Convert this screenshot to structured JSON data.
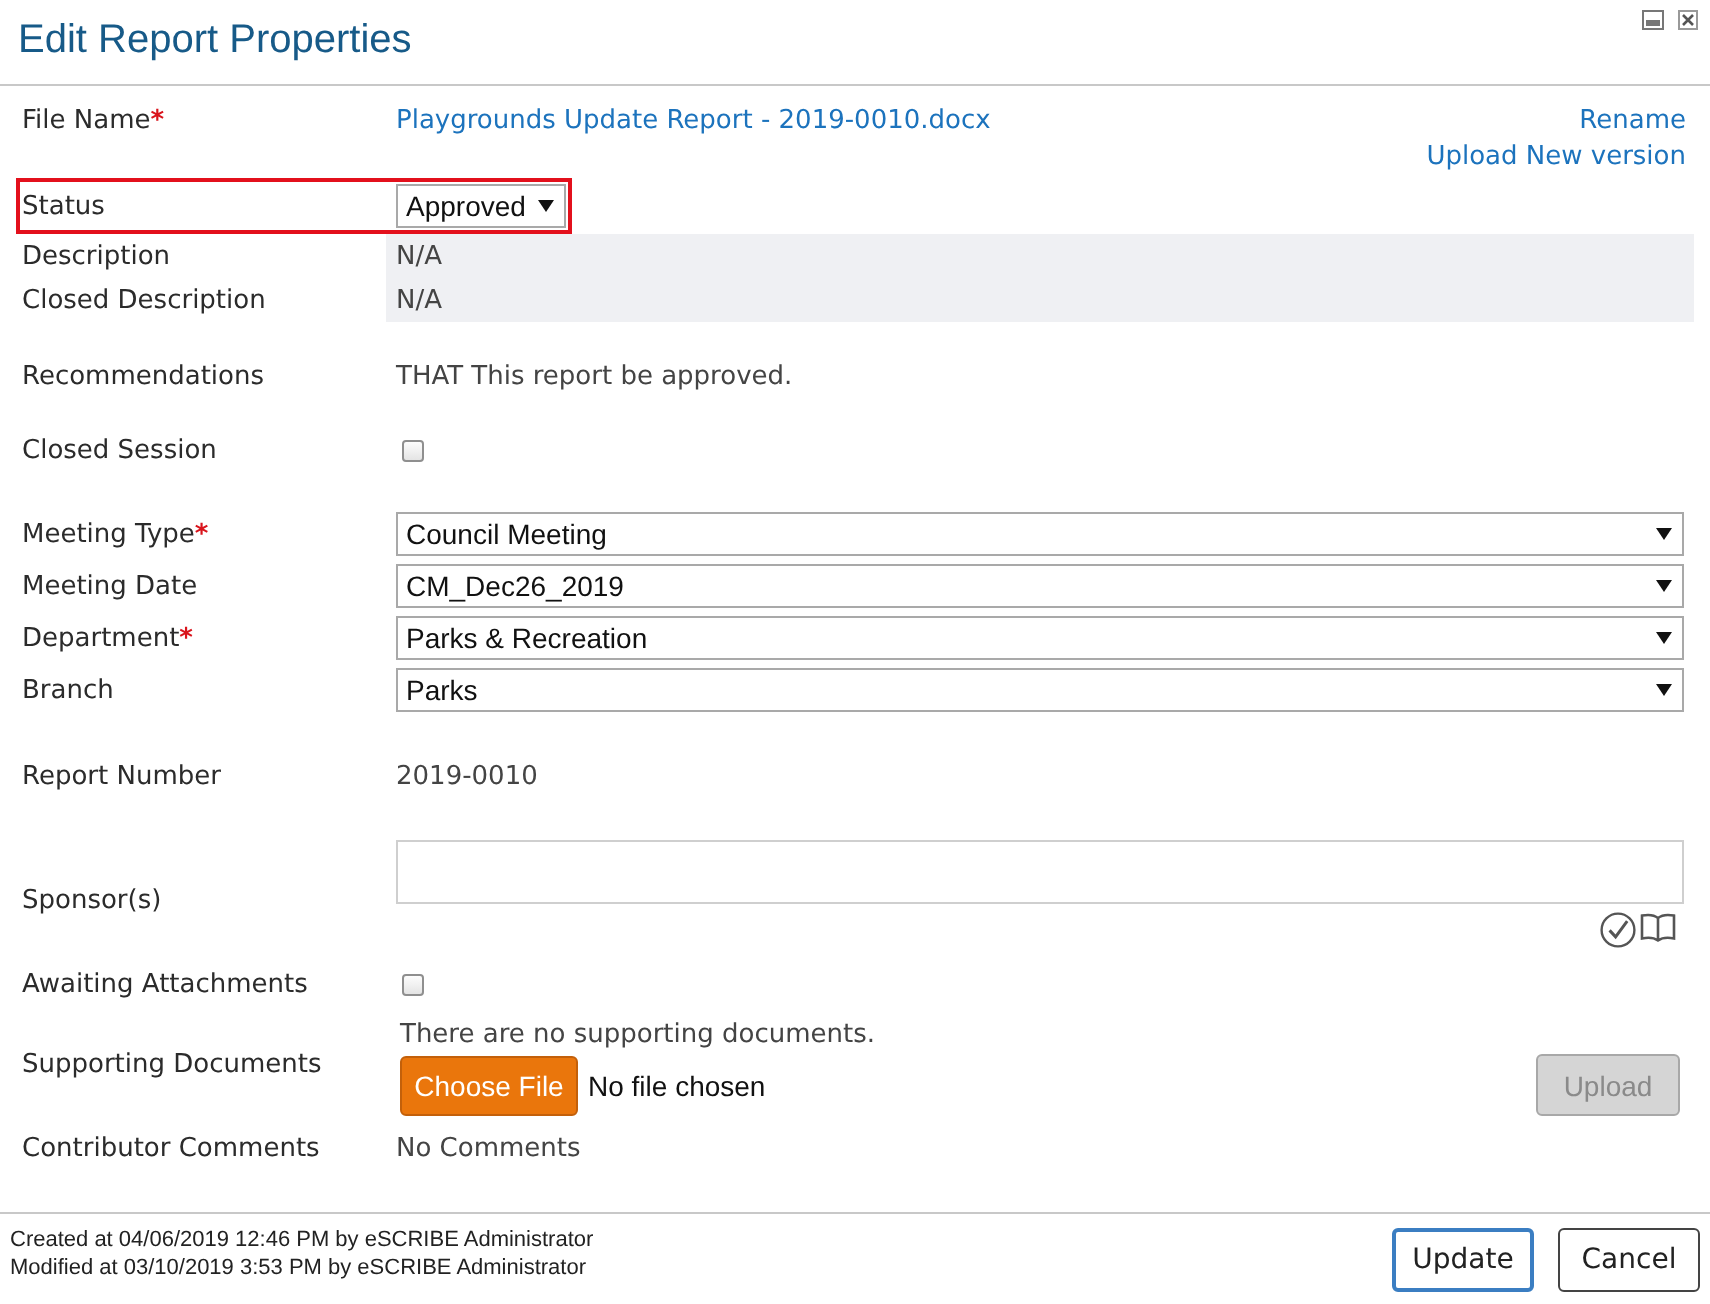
{
  "dialog": {
    "title": "Edit Report Properties"
  },
  "required_marker": "*",
  "sections": [
    {
      "fields": [
        {
          "kind": "link",
          "label": "File Name",
          "required": true,
          "highlighted": false,
          "value": "Playgrounds Update Report - 2019-0010.docx",
          "actions": [
            "Rename",
            "Upload New version"
          ]
        },
        {
          "kind": "short_select",
          "label": "Status",
          "required": false,
          "highlighted": true,
          "value": "Approved"
        },
        {
          "kind": "shaded",
          "label": "Description",
          "required": false,
          "highlighted": false,
          "value": "N/A"
        },
        {
          "kind": "shaded",
          "label": "Closed Description",
          "required": false,
          "highlighted": false,
          "value": "N/A"
        }
      ]
    },
    {
      "fields": [
        {
          "kind": "text",
          "label": "Recommendations",
          "required": false,
          "highlighted": false,
          "value": "THAT This report be approved."
        },
        {
          "kind": "checkbox",
          "label": "Closed Session",
          "required": false,
          "highlighted": false,
          "checked": false
        }
      ]
    },
    {
      "fields": [
        {
          "kind": "select",
          "label": "Meeting Type",
          "required": true,
          "highlighted": false,
          "value": "Council Meeting"
        },
        {
          "kind": "select",
          "label": "Meeting Date",
          "required": false,
          "highlighted": false,
          "value": "CM_Dec26_2019"
        },
        {
          "kind": "select",
          "label": "Department",
          "required": true,
          "highlighted": false,
          "value": "Parks & Recreation"
        },
        {
          "kind": "select",
          "label": "Branch",
          "required": false,
          "highlighted": false,
          "value": "Parks"
        }
      ]
    },
    {
      "fields": [
        {
          "kind": "text",
          "label": "Report Number",
          "required": false,
          "highlighted": false,
          "value": "2019-0010"
        },
        {
          "kind": "lookup",
          "label": "Sponsor(s)",
          "required": false,
          "highlighted": false
        },
        {
          "kind": "checkbox",
          "label": "Awaiting Attachments",
          "required": false,
          "highlighted": false,
          "checked": false
        },
        {
          "kind": "upload",
          "label": "Supporting Documents",
          "required": false,
          "highlighted": false,
          "message": "There are no supporting documents.",
          "choose_button": "Choose File",
          "file_status": "No file chosen",
          "upload_button": {
            "label": "Upload",
            "disabled": true
          }
        },
        {
          "kind": "text",
          "label": "Contributor Comments",
          "required": false,
          "highlighted": false,
          "value": "No Comments"
        }
      ]
    }
  ],
  "footer": {
    "created": "Created at 04/06/2019 12:46 PM by eSCRIBE Administrator",
    "modified": "Modified at 03/10/2019 3:53 PM by eSCRIBE Administrator",
    "buttons": [
      {
        "label": "Update",
        "primary": true
      },
      {
        "label": "Cancel",
        "primary": false
      }
    ]
  }
}
